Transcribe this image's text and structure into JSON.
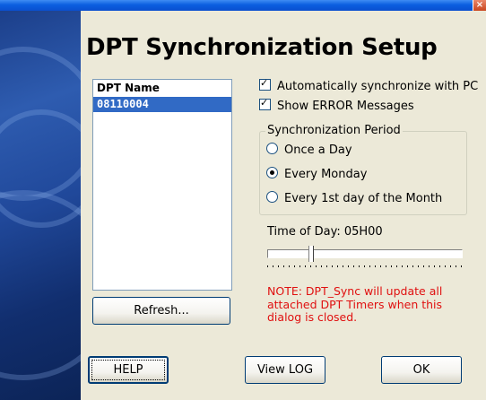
{
  "window": {
    "close_glyph": "×"
  },
  "title": "DPT Synchronization Setup",
  "dpt_list": {
    "header": "DPT Name",
    "items": [
      "08110004"
    ]
  },
  "refresh_label": "Refresh...",
  "options": {
    "auto_sync": {
      "label": "Automatically synchronize with PC",
      "checked": true
    },
    "show_errors": {
      "label": "Show ERROR Messages",
      "checked": true
    }
  },
  "period": {
    "label": "Synchronization Period",
    "options": [
      {
        "label": "Once a Day",
        "selected": false
      },
      {
        "label": "Every Monday",
        "selected": true
      },
      {
        "label": "Every 1st day of the Month",
        "selected": false
      }
    ]
  },
  "time_of_day": {
    "label": "Time of Day: 05H00"
  },
  "note": "NOTE: DPT_Sync will update all attached DPT Timers when this dialog is closed.",
  "buttons": {
    "help": "HELP",
    "view_log": "View LOG",
    "ok": "OK"
  },
  "colors": {
    "note": "#e01010",
    "selection": "#316ac5",
    "dialog_bg": "#ece9d8"
  }
}
